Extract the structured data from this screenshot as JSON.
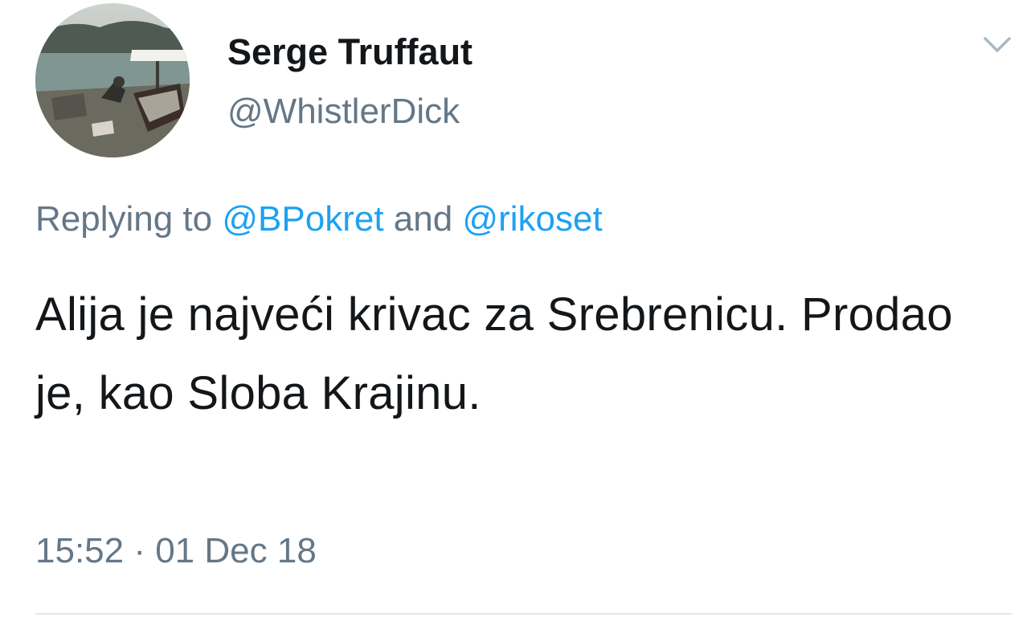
{
  "author": {
    "display_name": "Serge Truffaut",
    "handle": "@WhistlerDick"
  },
  "reply": {
    "prefix": "Replying to ",
    "mention_1": "@BPokret",
    "conjunction": " and ",
    "mention_2": "@rikoset"
  },
  "tweet": {
    "text": "Alija je najveći krivac za Srebrenicu. Prodao je, kao Sloba Krajinu.",
    "timestamp": "15:52 · 01 Dec 18"
  },
  "icons": {
    "menu": "chevron-down-icon",
    "avatar": "avatar-photo"
  },
  "colors": {
    "text_primary": "#14171a",
    "text_secondary": "#657786",
    "link": "#1da1f2",
    "divider": "#e1e8ed"
  }
}
